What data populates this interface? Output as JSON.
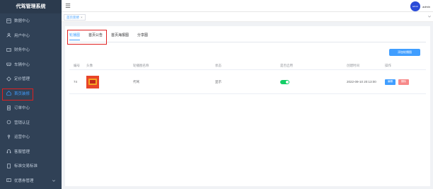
{
  "sidebar": {
    "brand": "代驾管理系统",
    "items": [
      {
        "label": "数据中心",
        "icon": "dashboard-icon"
      },
      {
        "label": "用户中心",
        "icon": "user-icon"
      },
      {
        "label": "财务中心",
        "icon": "wallet-icon"
      },
      {
        "label": "车辆中心",
        "icon": "car-icon"
      },
      {
        "label": "定价管理",
        "icon": "pricetag-icon"
      },
      {
        "label": "首页装修",
        "icon": "home-icon"
      },
      {
        "label": "订单中心",
        "icon": "order-icon"
      },
      {
        "label": "营销认证",
        "icon": "badge-icon"
      },
      {
        "label": "运营中心",
        "icon": "person-icon"
      },
      {
        "label": "客服管理",
        "icon": "service-icon"
      },
      {
        "label": "标准交易标准",
        "icon": "document-icon"
      },
      {
        "label": "优惠券管理",
        "icon": "coupon-icon"
      }
    ]
  },
  "header": {
    "avatar_text": "admin",
    "username": "admin"
  },
  "tagsbar": {
    "tag_label": "首页装修",
    "close": "×"
  },
  "tabs": [
    "轮播图",
    "首页公告",
    "首页海报图",
    "分享图"
  ],
  "add_button": "添加轮播图",
  "table": {
    "headers": [
      "编号",
      "头像",
      "轮播图名称",
      "状态",
      "是否启用",
      "创建时间",
      "操作"
    ],
    "rows": [
      {
        "id": "74",
        "name": "代驾",
        "status": "显示",
        "enabled": true,
        "created": "2022-09-10 20:13:00",
        "edit": "编辑",
        "delete": "删除"
      }
    ]
  },
  "colors": {
    "sidebar_bg": "#304156",
    "accent": "#409eff",
    "highlight": "#e02020",
    "switch_on": "#13ce66",
    "danger": "#f78989"
  }
}
